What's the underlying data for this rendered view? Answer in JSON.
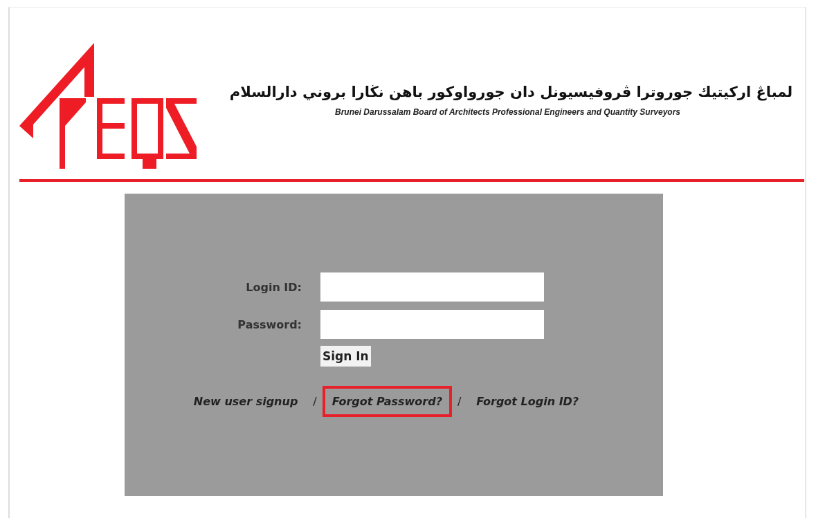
{
  "header": {
    "title_arabic": "لمباڠ اركيتيك جوروترا ڤروفيسيونل دان جورواوكور باهن نڬارا بروني دارالسلام",
    "title_english": "Brunei Darussalam Board of Architects Professional Engineers and Quantity Surveyors"
  },
  "login_form": {
    "fields": [
      {
        "label": "Login ID:"
      },
      {
        "label": "Password:"
      }
    ],
    "button": "Sign In",
    "links": [
      {
        "label": "New user signup",
        "highlighted": false
      },
      {
        "label": "Forgot Password?",
        "highlighted": true
      },
      {
        "label": "Forgot Login ID?",
        "highlighted": false
      }
    ],
    "separator": "/"
  }
}
